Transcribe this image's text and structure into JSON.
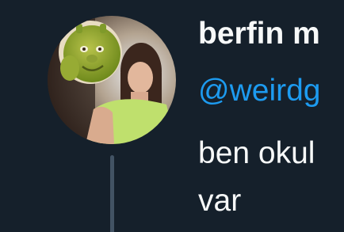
{
  "colors": {
    "background": "#15202b",
    "text_primary": "#f7f9f9",
    "accent": "#1d9bf0",
    "thread_line": "#425364"
  },
  "tweet": {
    "author": {
      "display_name": "berfin m",
      "handle": "@weirdg",
      "avatar": "profile-photo"
    },
    "text": "ben okul var"
  }
}
